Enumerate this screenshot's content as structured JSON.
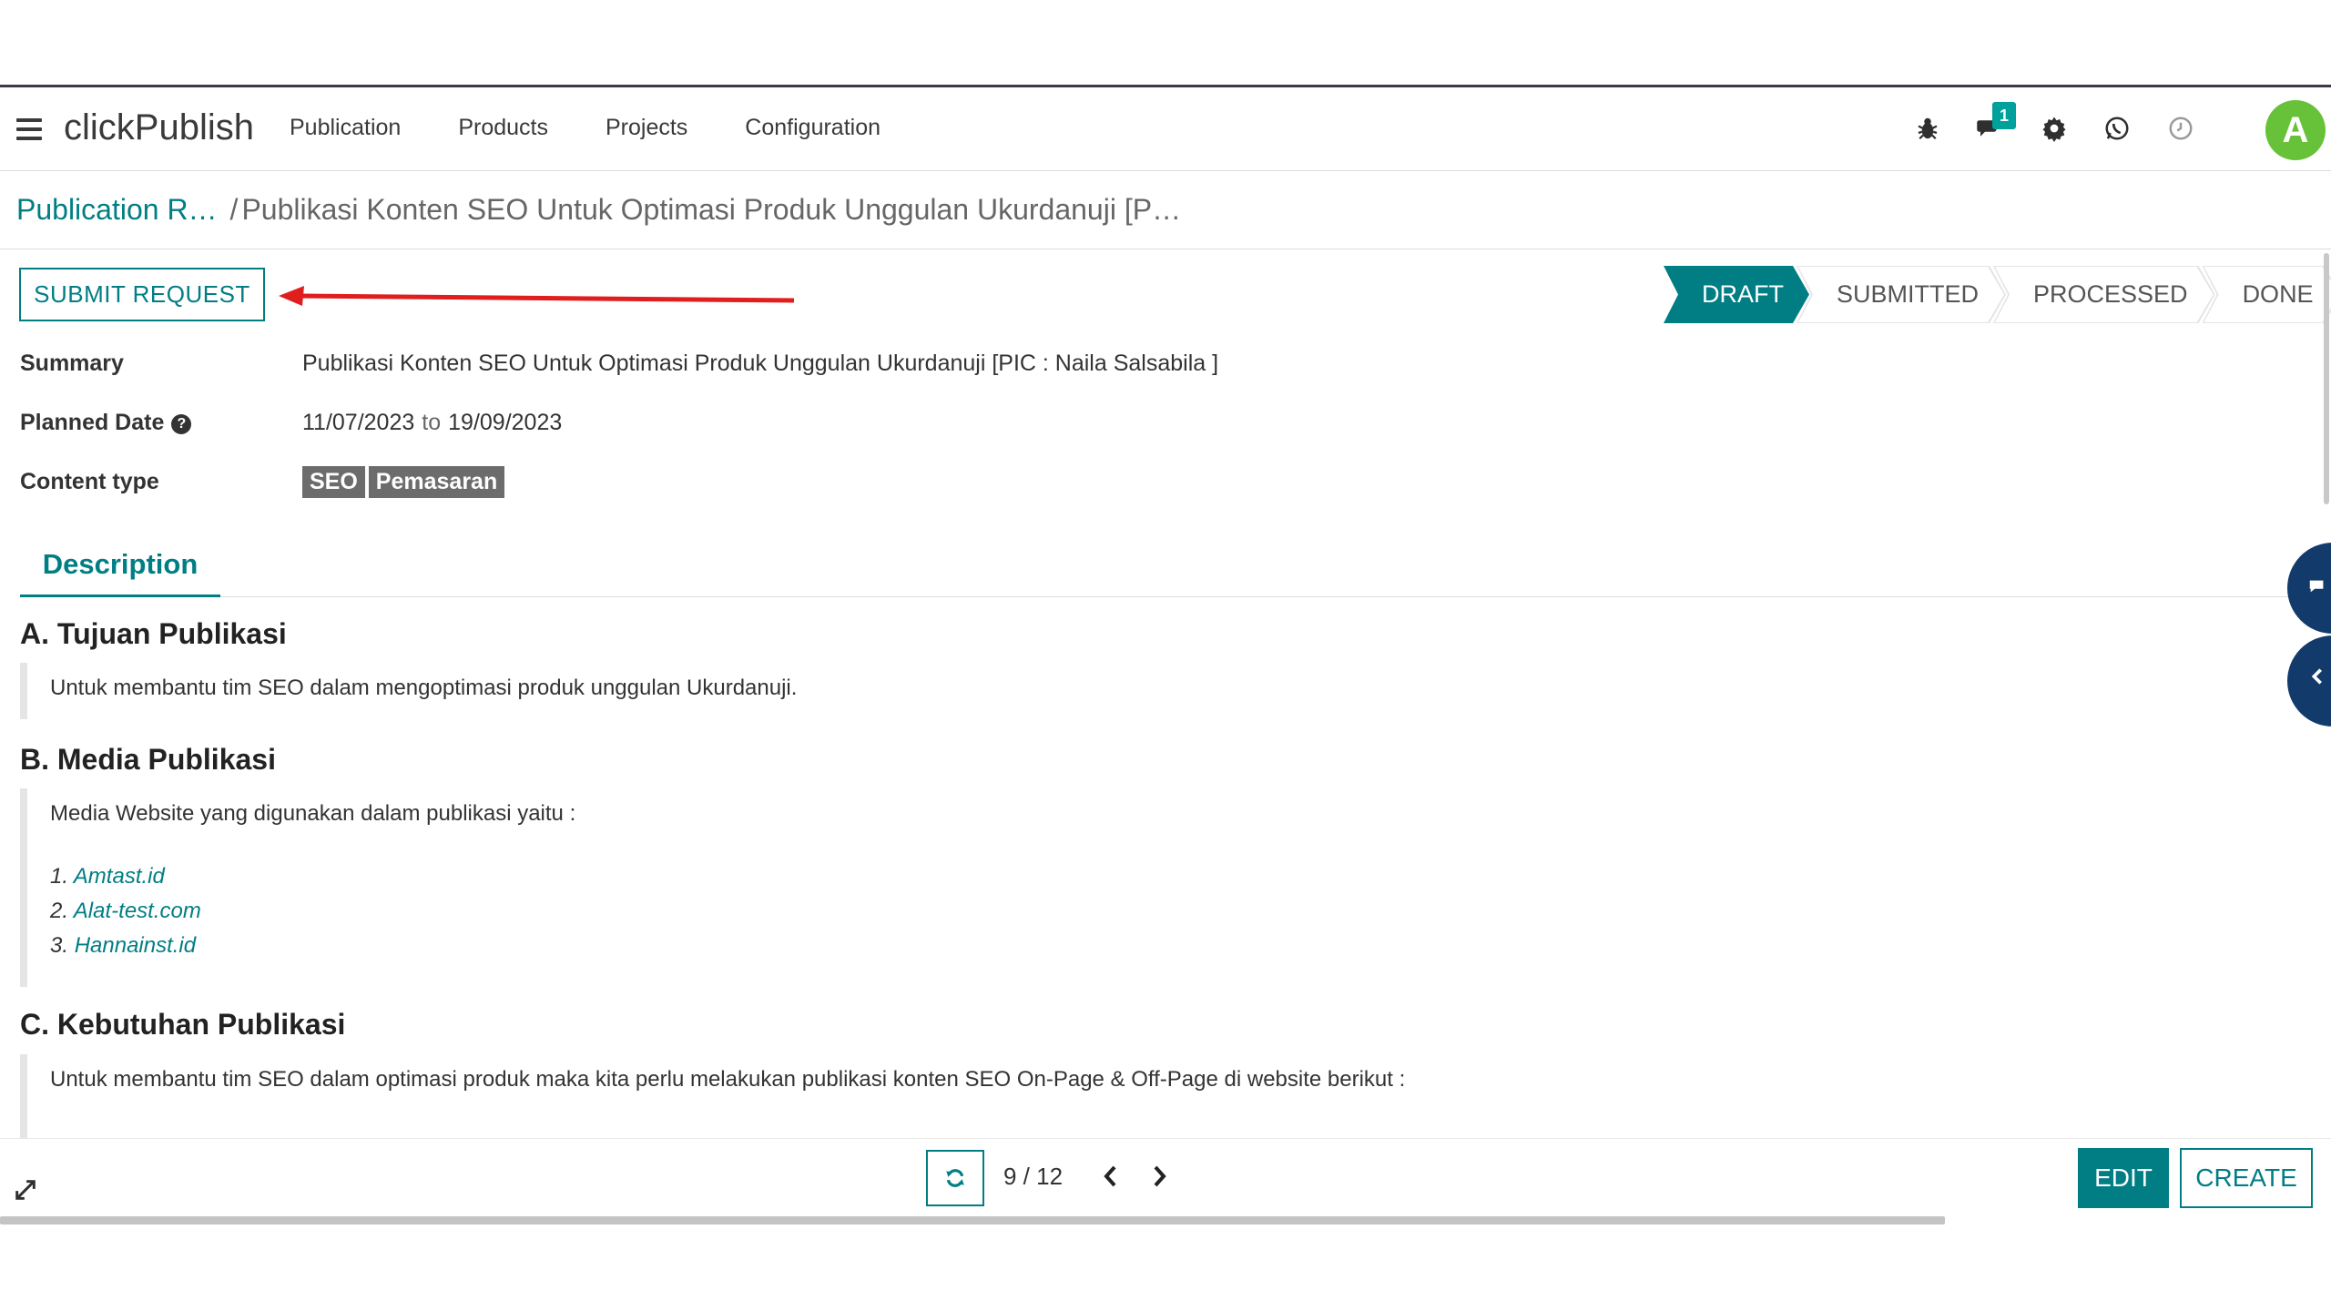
{
  "navbar": {
    "brand": "clickPublish",
    "menu": [
      "Publication",
      "Products",
      "Projects",
      "Configuration"
    ],
    "messages_badge": "1",
    "avatar_initial": "A",
    "avatar_color": "#67c23a",
    "icons": [
      "bug-icon",
      "chat-icon",
      "gear-icon",
      "whatsapp-icon",
      "clock-icon"
    ]
  },
  "breadcrumb": {
    "parent": "Publication R…",
    "separator": "/",
    "current": "Publikasi Konten SEO Untuk Optimasi Produk Unggulan Ukurdanuji [P…"
  },
  "actions": {
    "submit_label": "SUBMIT REQUEST"
  },
  "statusbar": {
    "stages": [
      "DRAFT",
      "SUBMITTED",
      "PROCESSED",
      "DONE"
    ],
    "active": "DRAFT",
    "accent": "#017e84"
  },
  "fields": {
    "summary_label": "Summary",
    "summary_value": "Publikasi Konten SEO Untuk Optimasi Produk Unggulan Ukurdanuji [PIC : Naila Salsabila ]",
    "planned_label": "Planned Date",
    "planned_help": "?",
    "planned_from": "11/07/2023",
    "planned_to_word": "to",
    "planned_to": "19/09/2023",
    "content_type_label": "Content type",
    "content_tags": [
      "SEO",
      "Pemasaran"
    ]
  },
  "tabs": {
    "active": "Description"
  },
  "description": {
    "a_title": "A. Tujuan Publikasi",
    "a_text": "Untuk membantu tim SEO dalam mengoptimasi produk unggulan Ukurdanuji.",
    "b_title": "B. Media Publikasi",
    "b_text": "Media Website yang digunakan dalam publikasi yaitu :",
    "b_list": [
      {
        "num": "1.",
        "text": "Amtast.id"
      },
      {
        "num": "2.",
        "text": "Alat-test.com"
      },
      {
        "num": "3.",
        "text": "Hannainst.id"
      }
    ],
    "c_title": "C. Kebutuhan Publikasi",
    "c_text": "Untuk membantu tim SEO dalam optimasi produk maka kita perlu melakukan publikasi konten SEO On-Page & Off-Page di website berikut :"
  },
  "pager": {
    "value": "9 / 12",
    "prev": "‹",
    "next": "›"
  },
  "bottom": {
    "edit_label": "EDIT",
    "create_label": "CREATE"
  }
}
